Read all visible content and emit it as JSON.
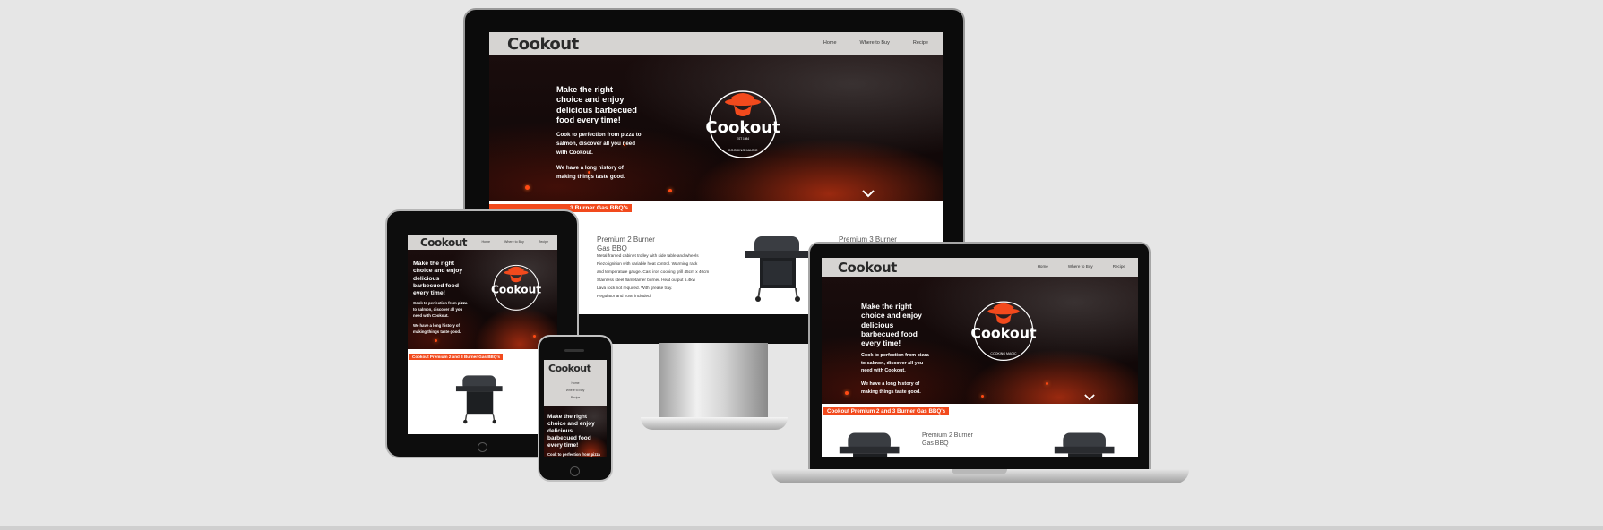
{
  "site": {
    "logo": "Cookout",
    "nav": [
      "Home",
      "Where to Buy",
      "Recipe"
    ],
    "hero_headline": "Make the right choice and enjoy delicious barbecued food every time!",
    "hero_sub_1": "Cook to perfection from pizza to salmon, discover all you need with Cookout.",
    "hero_sub_2": "We have a long history of making things taste good.",
    "emblem": {
      "brand": "Cookout",
      "est": "EST 1984",
      "arc_top": "MAKING DELICIOUS",
      "arc_bottom": "COOKING MAGIC"
    },
    "section_banner": "Cookout Premium 2 and 3 Burner Gas BBQ's",
    "monitor_banner_visible": "3 Burner Gas BBQ's",
    "product_1_title": "Premium 2 Burner Gas BBQ",
    "product_2_title": "Premium 3 Burner",
    "product_1_specs": [
      "Metal framed cabinet trolley with side table and wheels",
      "Piezo ignition with variable heat control. Warming rack",
      "and temperature gauge. Cast iron cooking grill 45cm x 40cm",
      "Stainless steel flametamer burner. Heat output 5.4kw",
      "Lava rock not required. With grease tray.",
      "Regulator and hose included"
    ]
  },
  "colors": {
    "accent": "#f24a1d",
    "header_bg": "#d6d4d2",
    "hero_bg": "#140909",
    "page_bg": "#e6e6e6"
  },
  "icons": [
    "chevron-down-icon",
    "chef-hat-emblem-icon",
    "grill-icon"
  ]
}
